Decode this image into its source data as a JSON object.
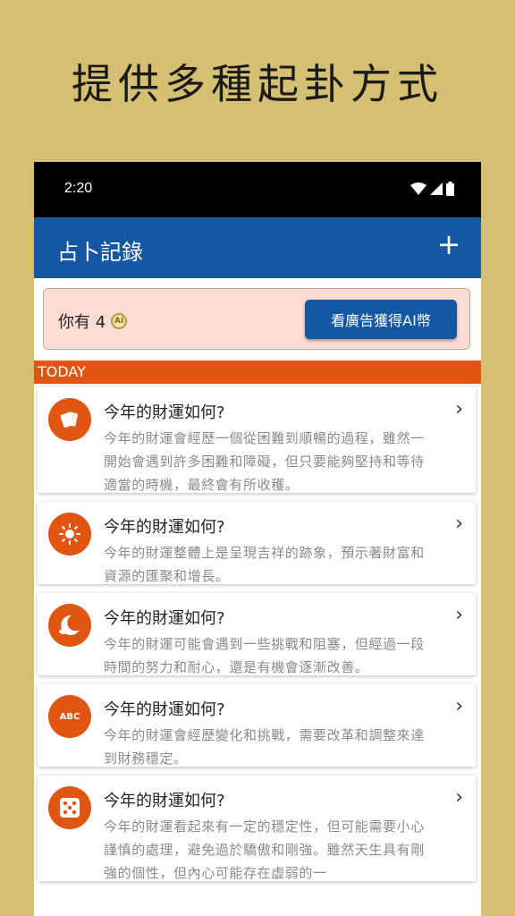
{
  "promo": {
    "title": "提供多種起卦方式"
  },
  "status_bar": {
    "time": "2:20"
  },
  "app_bar": {
    "title": "占卜記錄",
    "add_label": "+"
  },
  "coins": {
    "prefix": "你有 4",
    "coin_label": "AI",
    "ad_button": "看廣告獲得AI幣"
  },
  "section": {
    "label": "TODAY"
  },
  "records": [
    {
      "icon": "card-icon",
      "question": "今年的財運如何?",
      "answer": "今年的財運會經歷一個從困難到順暢的過程，雖然一開始會遇到許多困難和障礙，但只要能夠堅持和等待適當的時機，最終會有所收穫。"
    },
    {
      "icon": "sun-icon",
      "question": "今年的財運如何?",
      "answer": "今年的財運整體上是呈現吉祥的跡象，預示著財富和資源的匯聚和增長。"
    },
    {
      "icon": "moon-icon",
      "question": "今年的財運如何?",
      "answer": "今年的財運可能會遇到一些挑戰和阻塞，但經過一段時間的努力和耐心，還是有機會逐漸改善。"
    },
    {
      "icon": "abc-icon",
      "icon_text": "ABC",
      "question": "今年的財運如何?",
      "answer": "今年的財運會經歷變化和挑戰，需要改革和調整來達到財務穩定。"
    },
    {
      "icon": "dice-icon",
      "question": "今年的財運如何?",
      "answer": "今年的財運看起來有一定的穩定性，但可能需要小心謹慎的處理，避免過於驕傲和剛強。雖然天生具有剛強的個性，但內心可能存在虛弱的一"
    }
  ],
  "colors": {
    "background": "#d4bf72",
    "app_bar": "#1457a3",
    "accent": "#e05512",
    "coin_box": "#fddcd3"
  },
  "chevron": "›"
}
